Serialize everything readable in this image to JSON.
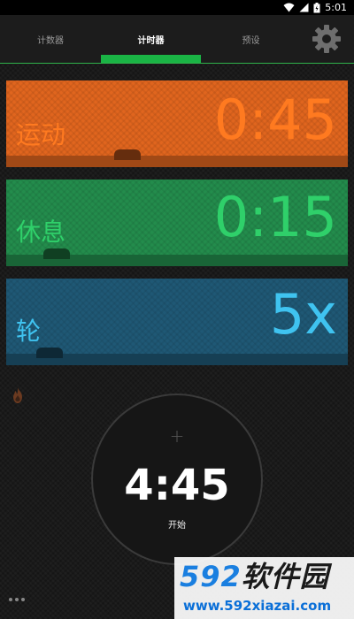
{
  "status_bar": {
    "time": "5:01"
  },
  "tabs": [
    {
      "label": "计数器",
      "active": false
    },
    {
      "label": "计时器",
      "active": true
    },
    {
      "label": "预设",
      "active": false
    }
  ],
  "cards": {
    "exercise": {
      "label": "运动",
      "value": "0:45",
      "color": "#e0651e",
      "accent": "#ff7a20"
    },
    "rest": {
      "label": "休息",
      "value": "0:15",
      "color": "#238c4c",
      "accent": "#2fd06a"
    },
    "rounds": {
      "label": "轮",
      "value": "5x",
      "color": "#1f5875",
      "accent": "#3fc3f0"
    }
  },
  "main_timer": {
    "time": "4:45",
    "start_label": "开始",
    "plus": "+"
  },
  "watermark": {
    "logo": "592软件园",
    "url": "www.592xiazai.com"
  },
  "icons": {
    "settings": "gear-icon",
    "fire": "flame-icon",
    "more": "more-dots-icon",
    "wifi": "wifi-icon",
    "signal": "signal-icon",
    "battery": "battery-icon"
  }
}
